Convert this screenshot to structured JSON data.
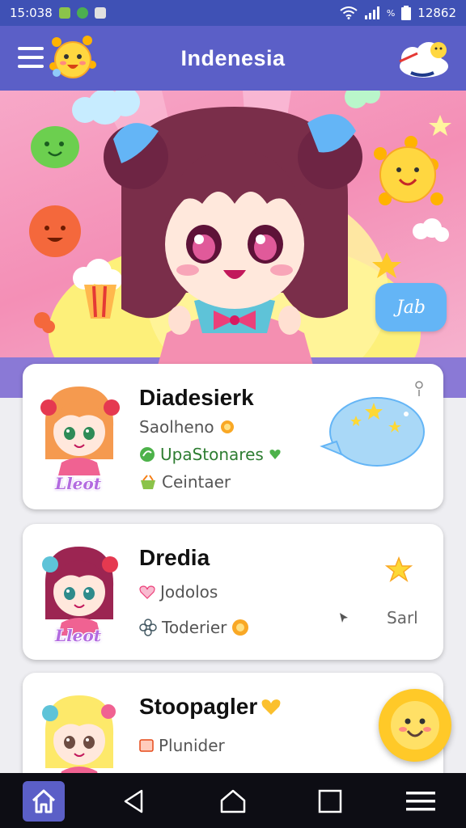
{
  "status_bar": {
    "time_left": "15:038",
    "time_right": "12862",
    "signal_label": "%"
  },
  "app_bar": {
    "title": "Indenesia"
  },
  "hero": {
    "button_label": "Jab"
  },
  "cards": [
    {
      "name": "Diadesierk",
      "line1": "Saolheno",
      "line2": "UpaStonares",
      "line3": "Ceintaer",
      "badge": "Lleot",
      "accent": "#4db24a"
    },
    {
      "name": "Dredia",
      "line1": "Jodolos",
      "line2": "Toderier",
      "badge": "Lleot",
      "extra": "Sarl"
    },
    {
      "name": "Stoopagler",
      "line1": "Plunider"
    }
  ],
  "colors": {
    "primary": "#5b5fc7",
    "status_bar": "#3f51b5",
    "badge_purple": "#b36be0",
    "fab_yellow": "#ffc928",
    "hero_pink": "#f48fb6"
  },
  "icons": [
    "menu-icon",
    "mascot-icon",
    "cloud-moon-icon",
    "wifi-icon",
    "signal-icon",
    "battery-icon",
    "star-icon",
    "speech-bubble-icon",
    "home-icon",
    "back-icon",
    "recents-icon",
    "hamburger-icon",
    "smiley-icon"
  ]
}
